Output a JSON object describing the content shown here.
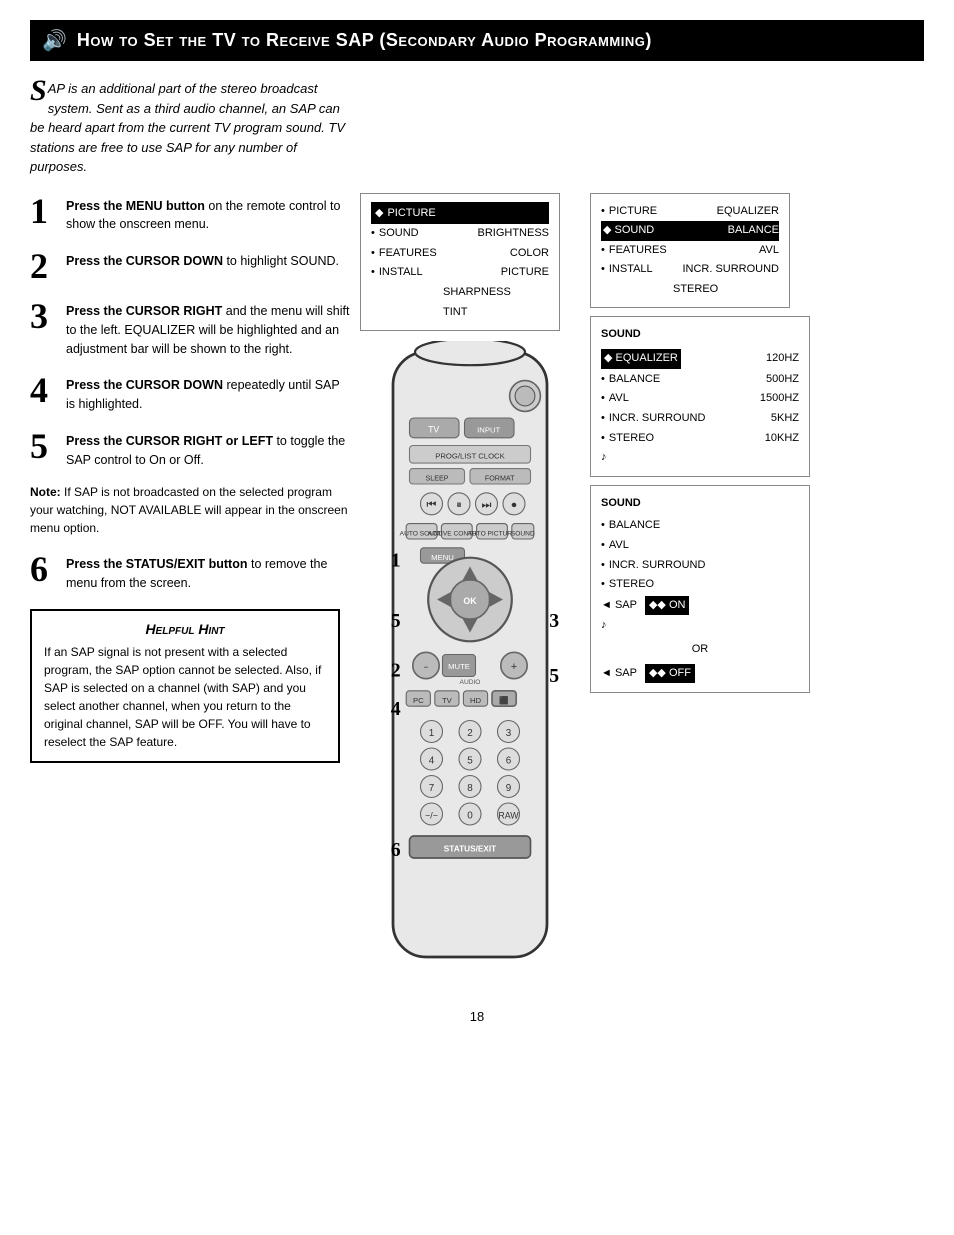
{
  "header": {
    "icon": "🔊",
    "title": "How to Set the TV to Receive SAP (Secondary Audio Programming)"
  },
  "intro": {
    "drop_cap": "S",
    "text": "AP is an additional part of the stereo broadcast system.  Sent as a third audio channel, an SAP can be heard apart from the current TV program sound.  TV stations are free to use SAP for any number of purposes."
  },
  "steps": [
    {
      "num": "1",
      "html": "<strong>Press the MENU button</strong> on the remote control to show the onscreen menu."
    },
    {
      "num": "2",
      "html": "<strong>Press the CURSOR DOWN</strong> to highlight SOUND."
    },
    {
      "num": "3",
      "html": "<strong>Press the CURSOR RIGHT</strong> and the menu will shift to the left. EQUALIZER will be highlighted and an adjustment bar will be shown to the right."
    },
    {
      "num": "4",
      "html": "<strong>Press the CURSOR DOWN</strong> repeatedly until SAP is highlighted."
    },
    {
      "num": "5",
      "html": "<strong>Press the CURSOR RIGHT or LEFT</strong> to toggle the SAP control to On or Off."
    }
  ],
  "note": "Note: If SAP is not broadcasted on the selected program your watching, NOT AVAILABLE will appear in the onscreen menu option.",
  "step6": {
    "num": "6",
    "html": "<strong>Press the STATUS/EXIT button</strong> to remove the menu from the screen."
  },
  "hint": {
    "title": "Helpful Hint",
    "text": "If an SAP signal is not present with a selected program, the SAP option cannot be selected.  Also, if SAP is selected on a channel (with SAP) and you select another channel, when you return to the original channel, SAP will be OFF.  You will have to reselect the SAP feature."
  },
  "menu1": {
    "title_arrow": "◆",
    "title": "PICTURE",
    "items": [
      {
        "bullet": "•",
        "label": "SOUND",
        "sub": ""
      },
      {
        "bullet": "•",
        "label": "FEATURES",
        "sub": ""
      },
      {
        "bullet": "•",
        "label": "INSTALL",
        "sub": ""
      }
    ],
    "right_items": [
      "BRIGHTNESS",
      "COLOR",
      "PICTURE",
      "SHARPNESS",
      "TINT"
    ]
  },
  "menu2": {
    "title_arrow": "◆",
    "title": "SOUND",
    "items": [
      {
        "bullet": "•",
        "label": "PICTURE",
        "sub": ""
      },
      {
        "bullet": "•",
        "label": "FEATURES",
        "sub": ""
      },
      {
        "bullet": "•",
        "label": "INSTALL",
        "sub": ""
      }
    ],
    "right_items": [
      "EQUALIZER",
      "BALANCE",
      "AVL",
      "INCR. SURROUND",
      "STEREO"
    ]
  },
  "menu3": {
    "section_title": "SOUND",
    "items": [
      {
        "bullet": "◆",
        "label": "EQUALIZER",
        "highlighted": true,
        "right": "120HZ"
      },
      {
        "bullet": "•",
        "label": "BALANCE",
        "highlighted": false,
        "right": "500HZ"
      },
      {
        "bullet": "•",
        "label": "AVL",
        "highlighted": false,
        "right": "1500HZ"
      },
      {
        "bullet": "•",
        "label": "INCR. SURROUND",
        "highlighted": false,
        "right": "5KHZ"
      },
      {
        "bullet": "•",
        "label": "STEREO",
        "highlighted": false,
        "right": "10KHZ"
      },
      {
        "bullet": "",
        "label": "♪",
        "highlighted": false,
        "right": ""
      }
    ]
  },
  "menu4": {
    "section_title": "SOUND",
    "items": [
      {
        "bullet": "•",
        "label": "BALANCE",
        "highlighted": false,
        "right": ""
      },
      {
        "bullet": "•",
        "label": "AVL",
        "highlighted": false,
        "right": ""
      },
      {
        "bullet": "•",
        "label": "INCR. SURROUND",
        "highlighted": false,
        "right": ""
      },
      {
        "bullet": "•",
        "label": "STEREO",
        "highlighted": false,
        "right": ""
      },
      {
        "bullet": "◄",
        "label": "SAP",
        "highlighted": true,
        "right": "◆◆ ON",
        "right_hl": true
      },
      {
        "bullet": "",
        "label": "♪",
        "highlighted": false,
        "right": ""
      }
    ],
    "or_label": "OR",
    "menu4b": {
      "bullet": "◄",
      "label": "SAP",
      "right": "◆◆ OFF",
      "right_hl": true
    }
  },
  "page_number": "18"
}
